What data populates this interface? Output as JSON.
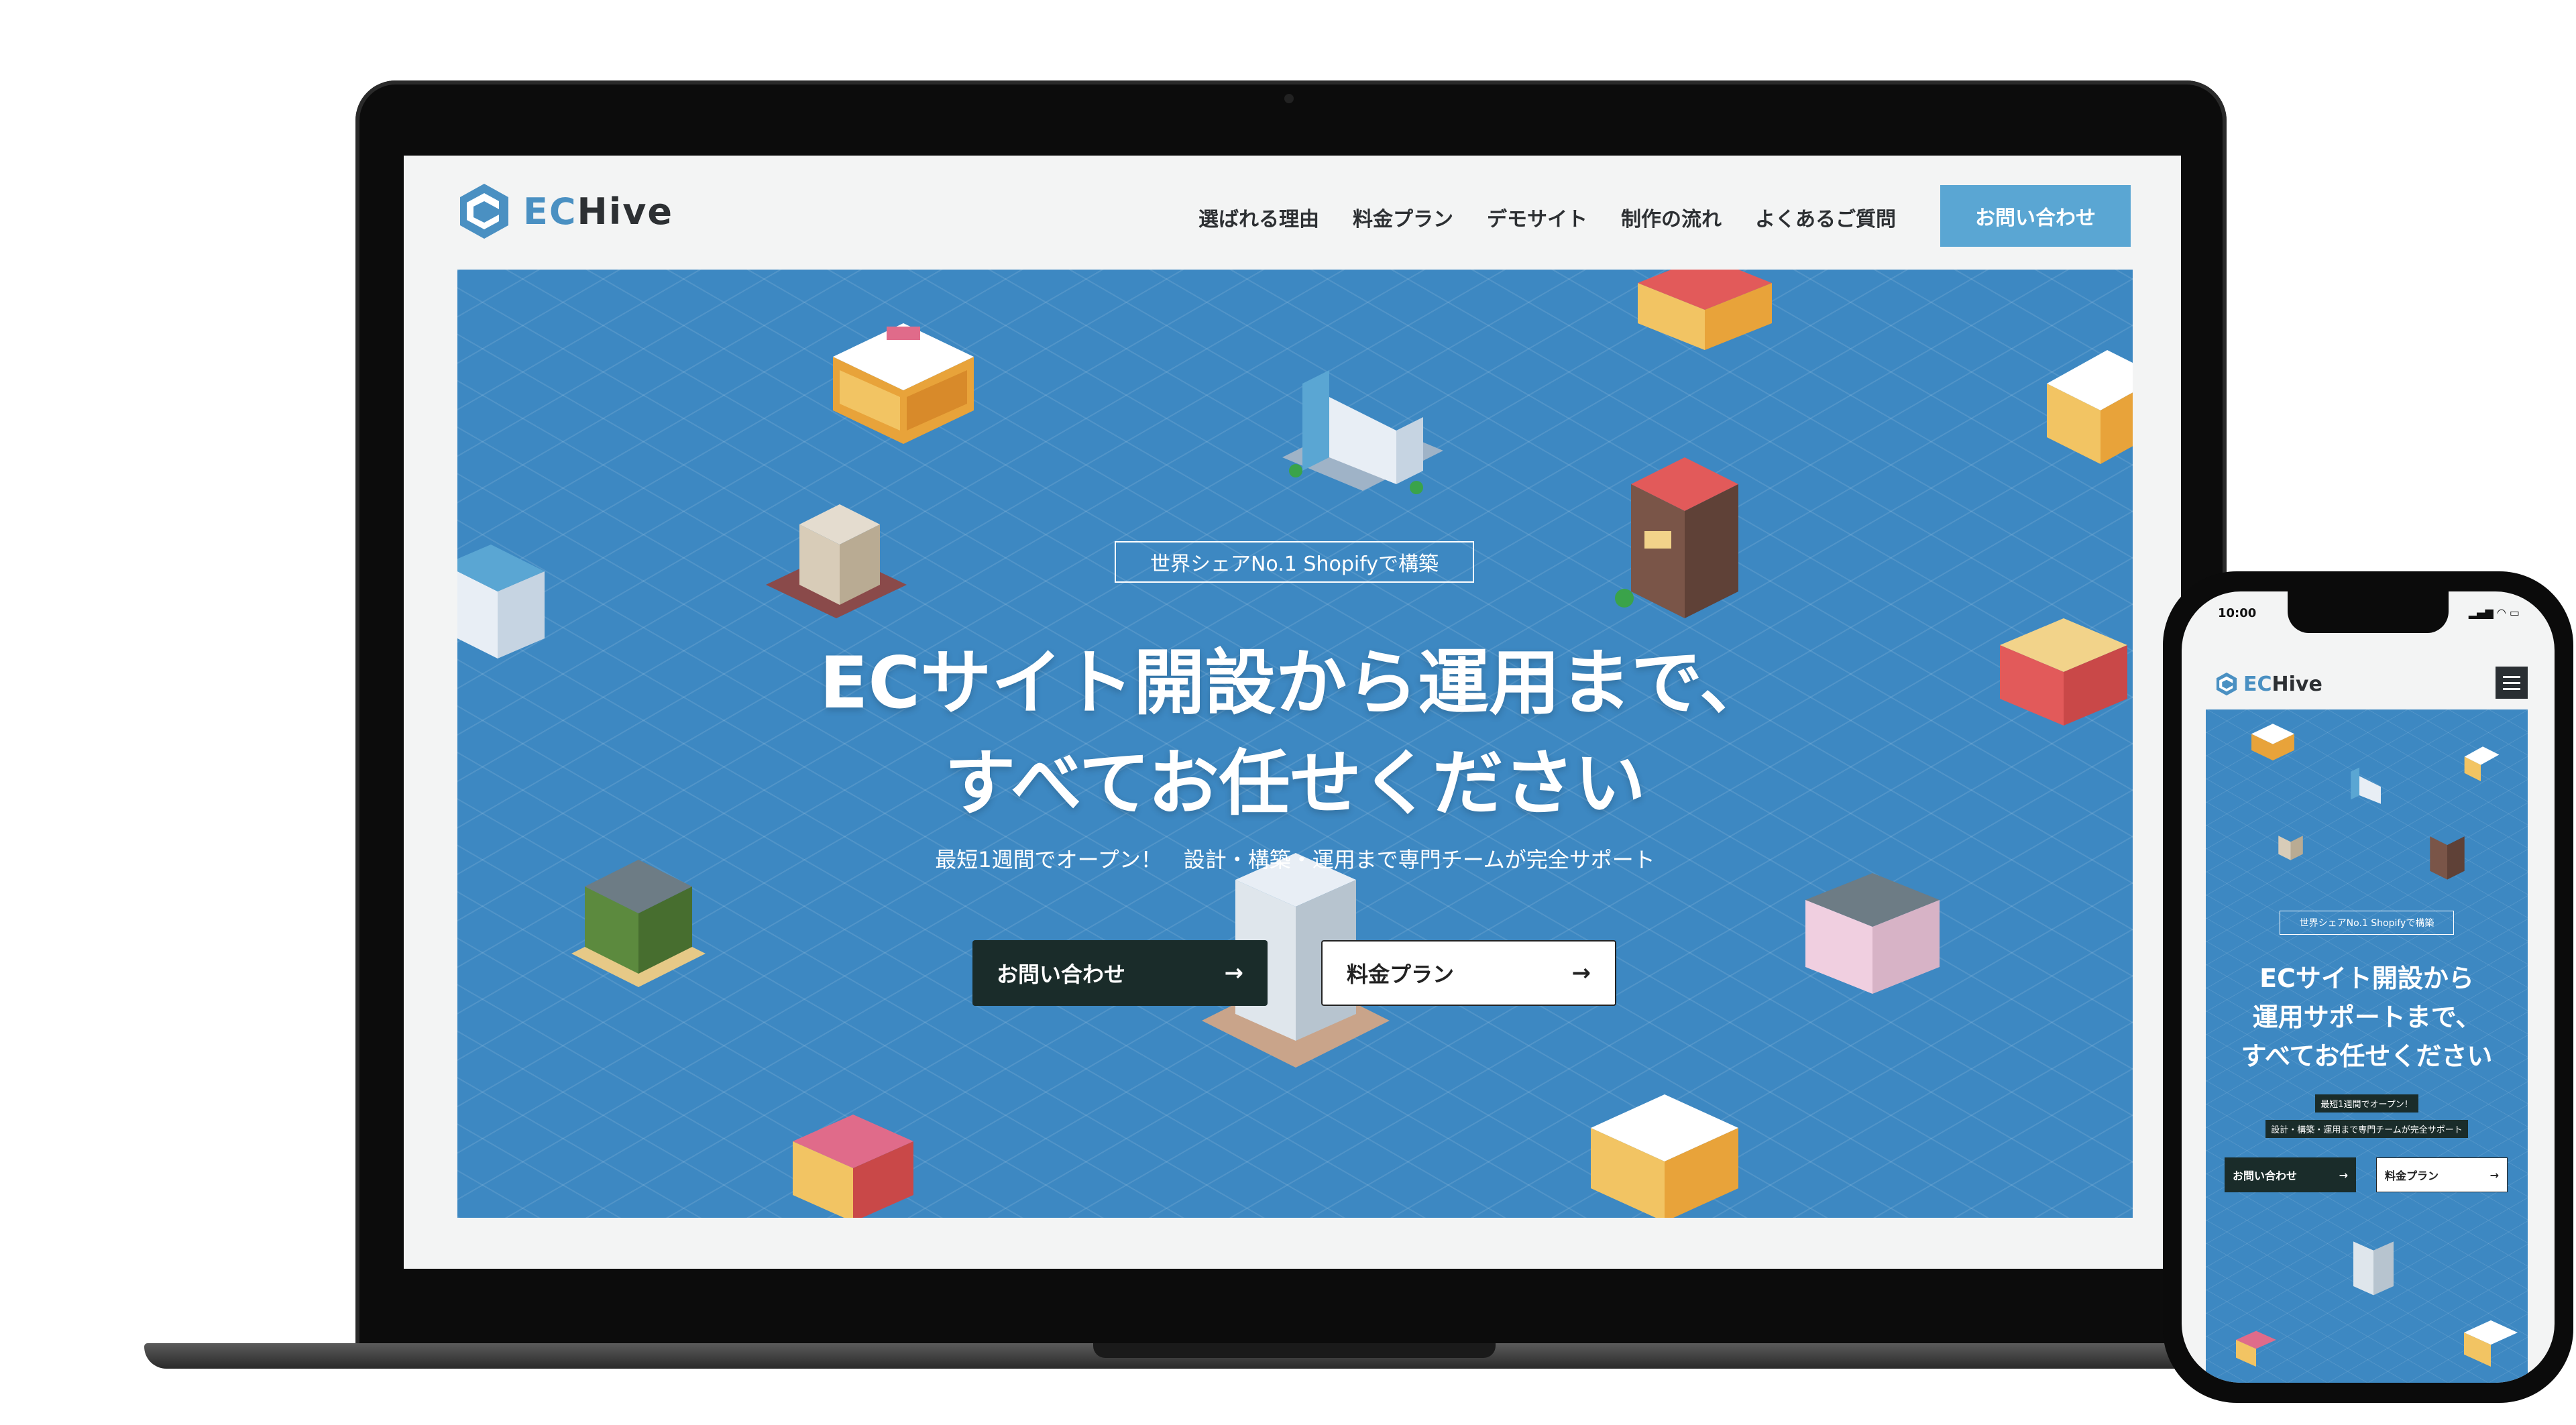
{
  "brand": {
    "name_prefix": "EC",
    "name_suffix": "Hive"
  },
  "nav": {
    "items": [
      "選ばれる理由",
      "料金プラン",
      "デモサイト",
      "制作の流れ",
      "よくあるご質問"
    ],
    "contact": "お問い合わせ"
  },
  "hero": {
    "badge": "世界シェアNo.1 Shopifyで構築",
    "headline_line1": "ECサイト開設から運用まで、",
    "headline_line2": "すべてお任せください",
    "subtext": "最短1週間でオープン！　設計・構築・運用まで専門チームが完全サポート",
    "cta_primary": "お問い合わせ",
    "cta_secondary": "料金プラン"
  },
  "mobile": {
    "status_time": "10:00",
    "badge": "世界シェアNo.1 Shopifyで構築",
    "headline_line1": "ECサイト開設から",
    "headline_line2": "運用サポートまで、",
    "headline_line3": "すべてお任せください",
    "sub_line1": "最短1週間でオープン！",
    "sub_line2": "設計・構築・運用まで専門チームが完全サポート",
    "cta_primary": "お問い合わせ",
    "cta_secondary": "料金プラン"
  },
  "colors": {
    "hero_bg": "#3d88c2",
    "accent": "#5aa6d3",
    "dark": "#1a2c2a",
    "brand_blue": "#4a90c2"
  },
  "icons": {
    "arrow": "→",
    "logo": "hexagon-e-logo-icon",
    "menu": "hamburger-menu-icon"
  }
}
